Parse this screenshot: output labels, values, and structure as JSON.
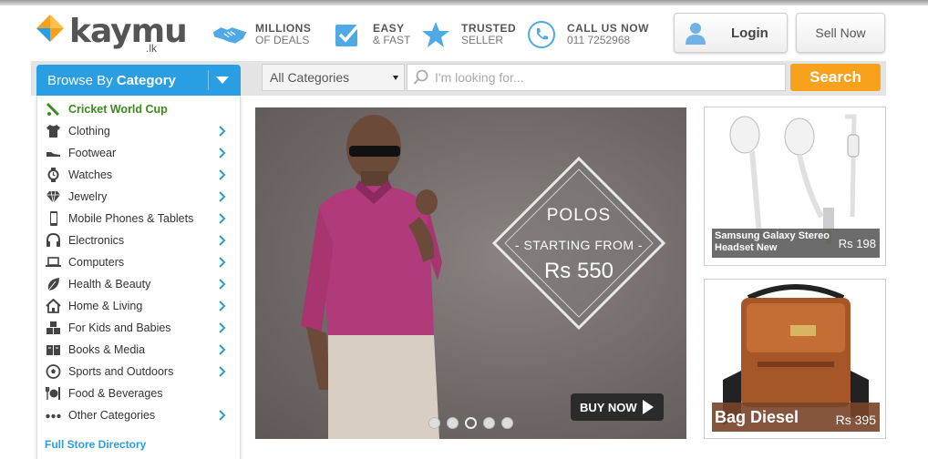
{
  "brand": {
    "name": "kaymu",
    "tld": ".lk",
    "colors": {
      "primary_blue": "#2a9ee3",
      "accent_orange": "#f7a11c",
      "category_green": "#3a8a1c"
    }
  },
  "header": {
    "usps": [
      {
        "icon": "handshake-icon",
        "line1": "MILLIONS",
        "line2": "OF DEALS"
      },
      {
        "icon": "checkbox-icon",
        "line1": "EASY",
        "line2": "& FAST"
      },
      {
        "icon": "star-icon",
        "line1": "TRUSTED",
        "line2": "SELLER"
      },
      {
        "icon": "phone-icon",
        "line1": "CALL US NOW",
        "line2": "011 7252968"
      }
    ],
    "login_label": "Login",
    "sell_label": "Sell Now"
  },
  "search": {
    "browse_prefix": "Browse By",
    "browse_bold": "Category",
    "category_selected": "All Categories",
    "placeholder": "I'm looking for...",
    "button_label": "Search"
  },
  "categories": [
    {
      "label": "Cricket World Cup",
      "icon": "cricket-bat-icon",
      "highlight": true,
      "has_sub": false
    },
    {
      "label": "Clothing",
      "icon": "shirt-icon",
      "has_sub": true
    },
    {
      "label": "Footwear",
      "icon": "shoe-icon",
      "has_sub": true
    },
    {
      "label": "Watches",
      "icon": "watch-icon",
      "has_sub": true
    },
    {
      "label": "Jewelry",
      "icon": "diamond-icon",
      "has_sub": true
    },
    {
      "label": "Mobile Phones & Tablets",
      "icon": "mobile-phone-icon",
      "has_sub": true
    },
    {
      "label": "Electronics",
      "icon": "headphones-icon",
      "has_sub": true
    },
    {
      "label": "Computers",
      "icon": "laptop-icon",
      "has_sub": true
    },
    {
      "label": "Health & Beauty",
      "icon": "leaf-icon",
      "has_sub": true
    },
    {
      "label": "Home & Living",
      "icon": "house-icon",
      "has_sub": true
    },
    {
      "label": "For Kids and Babies",
      "icon": "abc-blocks-icon",
      "has_sub": true
    },
    {
      "label": "Books & Media",
      "icon": "book-icon",
      "has_sub": true
    },
    {
      "label": "Sports and Outdoors",
      "icon": "soccer-ball-icon",
      "has_sub": true
    },
    {
      "label": "Food & Beverages",
      "icon": "fork-knife-icon",
      "has_sub": false
    },
    {
      "label": "Other Categories",
      "icon": "dots-icon",
      "has_sub": true
    }
  ],
  "full_directory_label": "Full Store Directory",
  "hero": {
    "title": "POLOS",
    "subtitle": "- STARTING FROM -",
    "price": "Rs 550",
    "cta": "BUY NOW",
    "slide_count": 5,
    "active_slide": 3
  },
  "products": [
    {
      "name": "Samsung Galaxy Stereo Headset New",
      "price": "Rs 198"
    },
    {
      "name": "Bag Diesel",
      "price": "Rs 395"
    }
  ]
}
